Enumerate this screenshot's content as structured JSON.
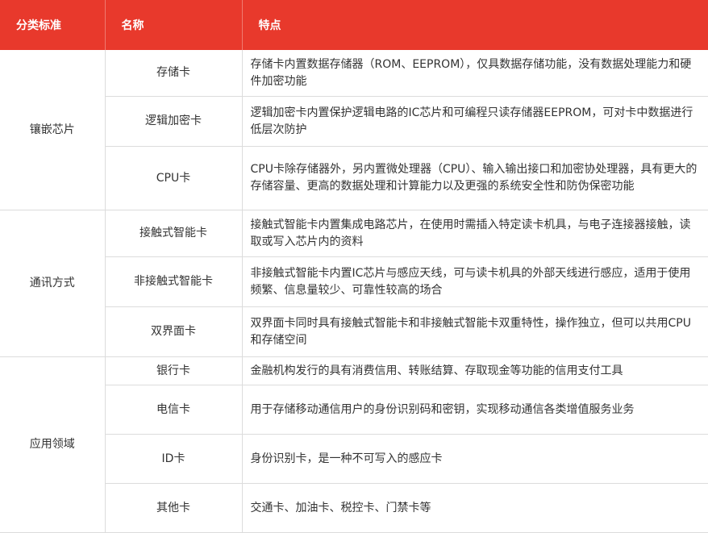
{
  "header": {
    "col1": "分类标准",
    "col2": "名称",
    "col3": "特点"
  },
  "groups": [
    {
      "category": "镶嵌芯片",
      "rows": [
        {
          "name": "存储卡",
          "feature": "存储卡内置数据存储器（ROM、EEPROM），仅具数据存储功能，没有数据处理能力和硬件加密功能"
        },
        {
          "name": "逻辑加密卡",
          "feature": "逻辑加密卡内置保护逻辑电路的IC芯片和可编程只读存储器EEPROM，可对卡中数据进行低层次防护"
        },
        {
          "name": "CPU卡",
          "feature": "CPU卡除存储器外，另内置微处理器（CPU）、输入输出接口和加密协处理器，具有更大的存储容量、更高的数据处理和计算能力以及更强的系统安全性和防伪保密功能"
        }
      ]
    },
    {
      "category": "通讯方式",
      "rows": [
        {
          "name": "接触式智能卡",
          "feature": "接触式智能卡内置集成电路芯片，在使用时需插入特定读卡机具，与电子连接器接触，读取或写入芯片内的资料"
        },
        {
          "name": "非接触式智能卡",
          "feature": "非接触式智能卡内置IC芯片与感应天线，可与读卡机具的外部天线进行感应，适用于使用频繁、信息量较少、可靠性较高的场合"
        },
        {
          "name": "双界面卡",
          "feature": "双界面卡同时具有接触式智能卡和非接触式智能卡双重特性，操作独立，但可以共用CPU和存储空间"
        }
      ]
    },
    {
      "category": "应用领域",
      "rows": [
        {
          "name": "银行卡",
          "feature": "金融机构发行的具有消费信用、转账结算、存取现金等功能的信用支付工具"
        },
        {
          "name": "电信卡",
          "feature": "用于存储移动通信用户的身份识别码和密钥，实现移动通信各类增值服务业务"
        },
        {
          "name": "ID卡",
          "feature": "身份识别卡，是一种不可写入的感应卡"
        },
        {
          "name": "其他卡",
          "feature": "交通卡、加油卡、税控卡、门禁卡等"
        }
      ]
    }
  ]
}
